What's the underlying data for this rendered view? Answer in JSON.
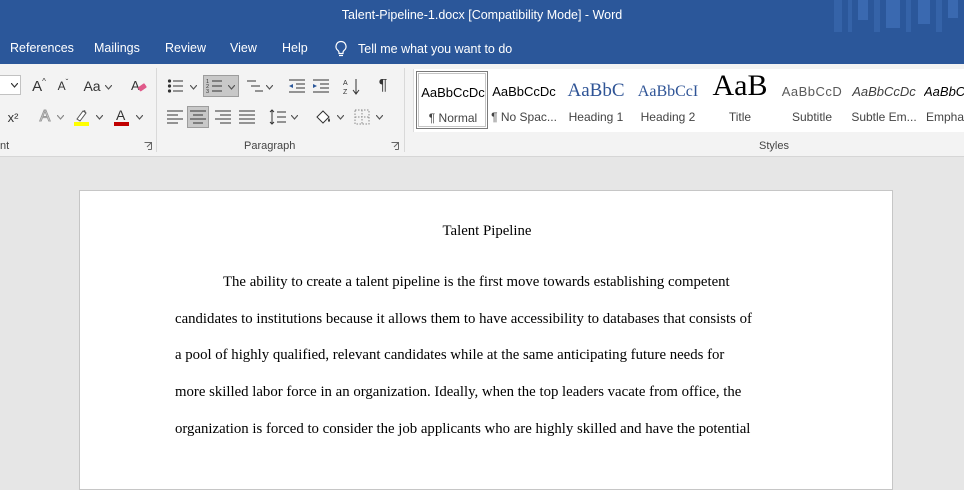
{
  "window": {
    "title": "Talent-Pipeline-1.docx [Compatibility Mode]  -  Word",
    "accent_color": "#2b579a"
  },
  "tabs": [
    {
      "label": "References"
    },
    {
      "label": "Mailings"
    },
    {
      "label": "Review"
    },
    {
      "label": "View"
    },
    {
      "label": "Help"
    }
  ],
  "tell_me": {
    "icon": "lightbulb-icon",
    "label": "Tell me what you want to do"
  },
  "ribbon": {
    "groups": {
      "font_partial": "nt",
      "paragraph": "Paragraph",
      "styles": "Styles"
    },
    "font": {
      "grow_label": "A",
      "shrink_label": "A",
      "case_label": "Aa",
      "superscript_label": "x²",
      "text_effects_label": "A",
      "font_color_label": "A",
      "highlight_color": "#ffff00",
      "font_color": "#c00000"
    },
    "styles_gallery": [
      {
        "sample": "AaBbCcDc",
        "name": "¶ Normal",
        "selected": true
      },
      {
        "sample": "AaBbCcDc",
        "name": "¶ No Spac..."
      },
      {
        "sample": "AaBbC",
        "name": "Heading 1"
      },
      {
        "sample": "AaBbCcI",
        "name": "Heading 2"
      },
      {
        "sample": "AaB",
        "name": "Title"
      },
      {
        "sample": "AaBbCcD",
        "name": "Subtitle"
      },
      {
        "sample": "AaBbCcDc",
        "name": "Subtle Em..."
      },
      {
        "sample": "AaBbCcDc",
        "name": "Empha"
      }
    ]
  },
  "document": {
    "title": "Talent Pipeline",
    "lines": [
      "The ability to create a talent pipeline is the first move towards establishing competent",
      "candidates to institutions because it allows them to have accessibility to databases that consists of",
      "a pool of highly qualified, relevant candidates while at the same anticipating future needs for",
      "more skilled labor force in an organization. Ideally, when the top leaders vacate from office, the",
      "organization is forced to consider the job applicants who are highly skilled and have the potential"
    ]
  }
}
